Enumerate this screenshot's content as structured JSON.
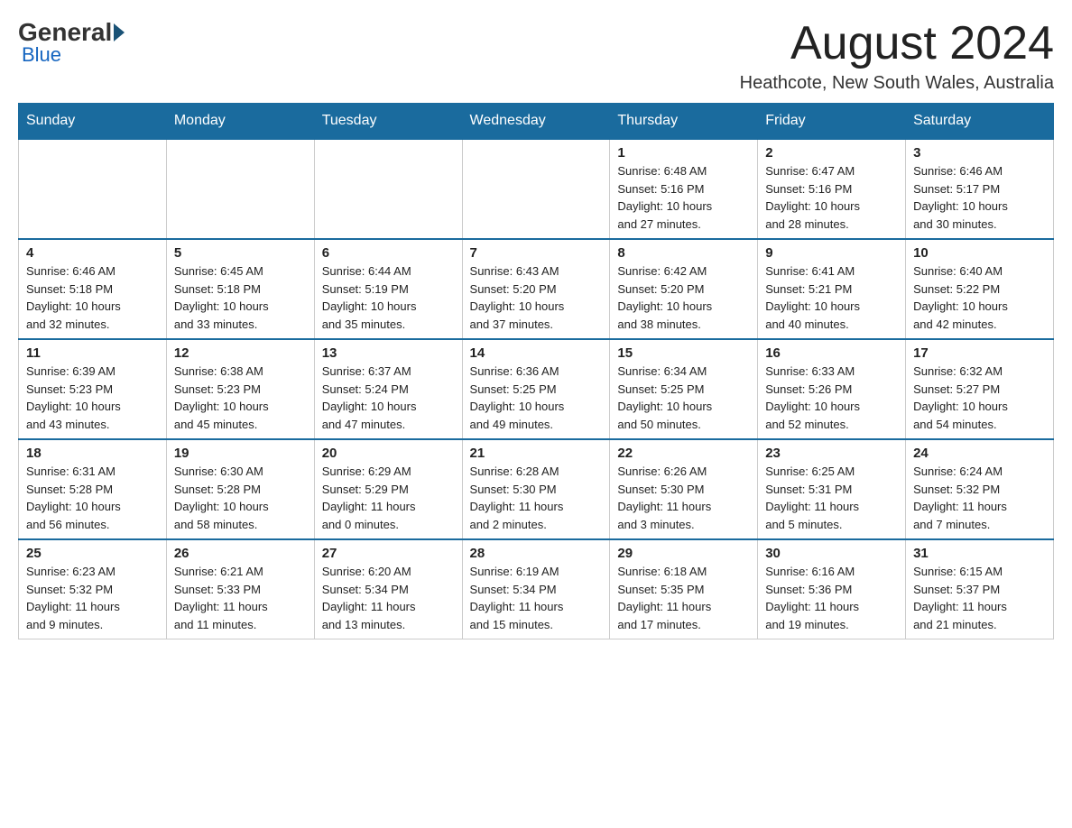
{
  "header": {
    "logo_general": "General",
    "logo_blue": "Blue",
    "title": "August 2024",
    "subtitle": "Heathcote, New South Wales, Australia"
  },
  "calendar": {
    "days_of_week": [
      "Sunday",
      "Monday",
      "Tuesday",
      "Wednesday",
      "Thursday",
      "Friday",
      "Saturday"
    ],
    "weeks": [
      [
        {
          "day": "",
          "info": ""
        },
        {
          "day": "",
          "info": ""
        },
        {
          "day": "",
          "info": ""
        },
        {
          "day": "",
          "info": ""
        },
        {
          "day": "1",
          "info": "Sunrise: 6:48 AM\nSunset: 5:16 PM\nDaylight: 10 hours\nand 27 minutes."
        },
        {
          "day": "2",
          "info": "Sunrise: 6:47 AM\nSunset: 5:16 PM\nDaylight: 10 hours\nand 28 minutes."
        },
        {
          "day": "3",
          "info": "Sunrise: 6:46 AM\nSunset: 5:17 PM\nDaylight: 10 hours\nand 30 minutes."
        }
      ],
      [
        {
          "day": "4",
          "info": "Sunrise: 6:46 AM\nSunset: 5:18 PM\nDaylight: 10 hours\nand 32 minutes."
        },
        {
          "day": "5",
          "info": "Sunrise: 6:45 AM\nSunset: 5:18 PM\nDaylight: 10 hours\nand 33 minutes."
        },
        {
          "day": "6",
          "info": "Sunrise: 6:44 AM\nSunset: 5:19 PM\nDaylight: 10 hours\nand 35 minutes."
        },
        {
          "day": "7",
          "info": "Sunrise: 6:43 AM\nSunset: 5:20 PM\nDaylight: 10 hours\nand 37 minutes."
        },
        {
          "day": "8",
          "info": "Sunrise: 6:42 AM\nSunset: 5:20 PM\nDaylight: 10 hours\nand 38 minutes."
        },
        {
          "day": "9",
          "info": "Sunrise: 6:41 AM\nSunset: 5:21 PM\nDaylight: 10 hours\nand 40 minutes."
        },
        {
          "day": "10",
          "info": "Sunrise: 6:40 AM\nSunset: 5:22 PM\nDaylight: 10 hours\nand 42 minutes."
        }
      ],
      [
        {
          "day": "11",
          "info": "Sunrise: 6:39 AM\nSunset: 5:23 PM\nDaylight: 10 hours\nand 43 minutes."
        },
        {
          "day": "12",
          "info": "Sunrise: 6:38 AM\nSunset: 5:23 PM\nDaylight: 10 hours\nand 45 minutes."
        },
        {
          "day": "13",
          "info": "Sunrise: 6:37 AM\nSunset: 5:24 PM\nDaylight: 10 hours\nand 47 minutes."
        },
        {
          "day": "14",
          "info": "Sunrise: 6:36 AM\nSunset: 5:25 PM\nDaylight: 10 hours\nand 49 minutes."
        },
        {
          "day": "15",
          "info": "Sunrise: 6:34 AM\nSunset: 5:25 PM\nDaylight: 10 hours\nand 50 minutes."
        },
        {
          "day": "16",
          "info": "Sunrise: 6:33 AM\nSunset: 5:26 PM\nDaylight: 10 hours\nand 52 minutes."
        },
        {
          "day": "17",
          "info": "Sunrise: 6:32 AM\nSunset: 5:27 PM\nDaylight: 10 hours\nand 54 minutes."
        }
      ],
      [
        {
          "day": "18",
          "info": "Sunrise: 6:31 AM\nSunset: 5:28 PM\nDaylight: 10 hours\nand 56 minutes."
        },
        {
          "day": "19",
          "info": "Sunrise: 6:30 AM\nSunset: 5:28 PM\nDaylight: 10 hours\nand 58 minutes."
        },
        {
          "day": "20",
          "info": "Sunrise: 6:29 AM\nSunset: 5:29 PM\nDaylight: 11 hours\nand 0 minutes."
        },
        {
          "day": "21",
          "info": "Sunrise: 6:28 AM\nSunset: 5:30 PM\nDaylight: 11 hours\nand 2 minutes."
        },
        {
          "day": "22",
          "info": "Sunrise: 6:26 AM\nSunset: 5:30 PM\nDaylight: 11 hours\nand 3 minutes."
        },
        {
          "day": "23",
          "info": "Sunrise: 6:25 AM\nSunset: 5:31 PM\nDaylight: 11 hours\nand 5 minutes."
        },
        {
          "day": "24",
          "info": "Sunrise: 6:24 AM\nSunset: 5:32 PM\nDaylight: 11 hours\nand 7 minutes."
        }
      ],
      [
        {
          "day": "25",
          "info": "Sunrise: 6:23 AM\nSunset: 5:32 PM\nDaylight: 11 hours\nand 9 minutes."
        },
        {
          "day": "26",
          "info": "Sunrise: 6:21 AM\nSunset: 5:33 PM\nDaylight: 11 hours\nand 11 minutes."
        },
        {
          "day": "27",
          "info": "Sunrise: 6:20 AM\nSunset: 5:34 PM\nDaylight: 11 hours\nand 13 minutes."
        },
        {
          "day": "28",
          "info": "Sunrise: 6:19 AM\nSunset: 5:34 PM\nDaylight: 11 hours\nand 15 minutes."
        },
        {
          "day": "29",
          "info": "Sunrise: 6:18 AM\nSunset: 5:35 PM\nDaylight: 11 hours\nand 17 minutes."
        },
        {
          "day": "30",
          "info": "Sunrise: 6:16 AM\nSunset: 5:36 PM\nDaylight: 11 hours\nand 19 minutes."
        },
        {
          "day": "31",
          "info": "Sunrise: 6:15 AM\nSunset: 5:37 PM\nDaylight: 11 hours\nand 21 minutes."
        }
      ]
    ]
  }
}
